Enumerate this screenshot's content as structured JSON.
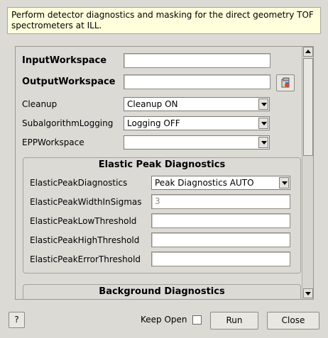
{
  "description": "Perform detector diagnostics and masking for the direct geometry TOF spectrometers at ILL.",
  "properties": {
    "input_workspace": {
      "label": "InputWorkspace",
      "value": ""
    },
    "output_workspace": {
      "label": "OutputWorkspace",
      "value": ""
    },
    "cleanup": {
      "label": "Cleanup",
      "value": "Cleanup ON"
    },
    "subalgorithm_logging": {
      "label": "SubalgorithmLogging",
      "value": "Logging OFF"
    },
    "epp_workspace": {
      "label": "EPPWorkspace",
      "value": ""
    }
  },
  "elastic_group": {
    "title": "Elastic Peak Diagnostics",
    "diagnostics": {
      "label": "ElasticPeakDiagnostics",
      "value": "Peak Diagnostics AUTO"
    },
    "width_in_sigmas": {
      "label": "ElasticPeakWidthInSigmas",
      "placeholder": "3"
    },
    "low_threshold": {
      "label": "ElasticPeakLowThreshold",
      "value": ""
    },
    "high_threshold": {
      "label": "ElasticPeakHighThreshold",
      "value": ""
    },
    "error_threshold": {
      "label": "ElasticPeakErrorThreshold",
      "value": ""
    }
  },
  "background_group": {
    "title": "Background Diagnostics"
  },
  "footer": {
    "help_label": "?",
    "keep_open_label": "Keep Open",
    "keep_open_checked": false,
    "run_label": "Run",
    "close_label": "Close"
  },
  "icons": {
    "browse": "folder-icon"
  }
}
